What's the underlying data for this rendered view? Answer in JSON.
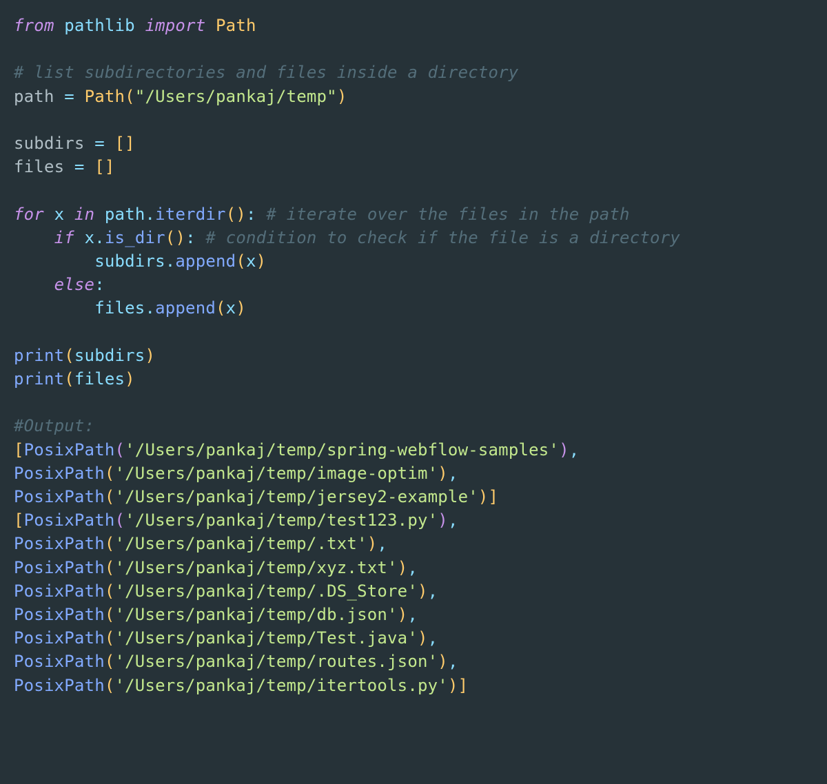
{
  "code": {
    "l1": {
      "kw_from": "from",
      "module": "pathlib",
      "kw_import": "import",
      "cls": "Path"
    },
    "l3_comment": "# list subdirectories and files inside a directory",
    "l4": {
      "var": "path",
      "assign": " = ",
      "cls": "Path",
      "arg": "\"/Users/pankaj/temp\""
    },
    "l6": {
      "var": "subdirs",
      "assign": " = ",
      "val": "[]"
    },
    "l7": {
      "var": "files",
      "assign": " = ",
      "val": "[]"
    },
    "l9": {
      "kw_for": "for",
      "x": "x",
      "kw_in": "in",
      "obj": "path",
      "method": "iterdir",
      "comment": "# iterate over the files in the path"
    },
    "l10": {
      "kw_if": "if",
      "x": "x",
      "method": "is_dir",
      "comment": "# condition to check if the file is a directory"
    },
    "l11": {
      "obj": "subdirs",
      "method": "append",
      "arg": "x"
    },
    "l12": {
      "kw_else": "else"
    },
    "l13": {
      "obj": "files",
      "method": "append",
      "arg": "x"
    },
    "l15": {
      "fn": "print",
      "arg": "subdirs"
    },
    "l16": {
      "fn": "print",
      "arg": "files"
    },
    "l18_comment": "#Output:",
    "out_lines": [
      {
        "prefix": "[",
        "name": "PosixPath",
        "path": "'/Users/pankaj/temp/spring-webflow-samples'",
        "suffix": "),"
      },
      {
        "prefix": "",
        "name": "PosixPath",
        "path": "'/Users/pankaj/temp/image-optim'",
        "suffix": "),"
      },
      {
        "prefix": "",
        "name": "PosixPath",
        "path": "'/Users/pankaj/temp/jersey2-example'",
        "suffix": ")]"
      },
      {
        "prefix": "[",
        "name": "PosixPath",
        "path": "'/Users/pankaj/temp/test123.py'",
        "suffix": "),"
      },
      {
        "prefix": "",
        "name": "PosixPath",
        "path": "'/Users/pankaj/temp/.txt'",
        "suffix": "),"
      },
      {
        "prefix": "",
        "name": "PosixPath",
        "path": "'/Users/pankaj/temp/xyz.txt'",
        "suffix": "),"
      },
      {
        "prefix": "",
        "name": "PosixPath",
        "path": "'/Users/pankaj/temp/.DS_Store'",
        "suffix": "),"
      },
      {
        "prefix": "",
        "name": "PosixPath",
        "path": "'/Users/pankaj/temp/db.json'",
        "suffix": "),"
      },
      {
        "prefix": "",
        "name": "PosixPath",
        "path": "'/Users/pankaj/temp/Test.java'",
        "suffix": "),"
      },
      {
        "prefix": "",
        "name": "PosixPath",
        "path": "'/Users/pankaj/temp/routes.json'",
        "suffix": "),"
      },
      {
        "prefix": "",
        "name": "PosixPath",
        "path": "'/Users/pankaj/temp/itertools.py'",
        "suffix": ")]"
      }
    ]
  }
}
